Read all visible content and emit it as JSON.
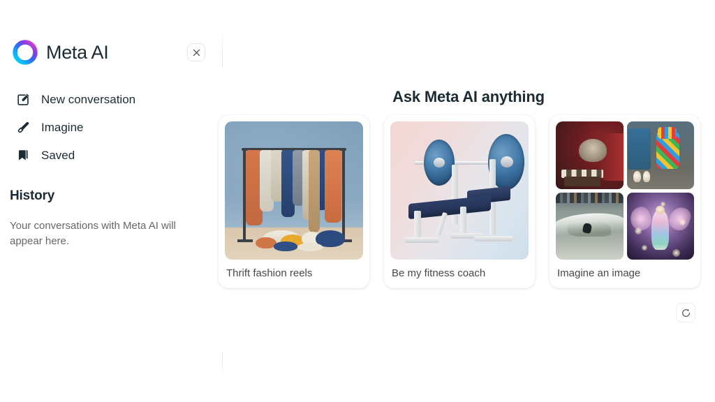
{
  "brand": {
    "title": "Meta AI",
    "logo_icon": "meta-ai-ring-logo",
    "logo_gradient_start": "#0ac2ff",
    "logo_gradient_mid": "#2b6bf5",
    "logo_gradient_end": "#c034e0"
  },
  "sidebar": {
    "close_icon": "close-icon",
    "items": [
      {
        "label": "New conversation",
        "icon": "compose-icon"
      },
      {
        "label": "Imagine",
        "icon": "brush-icon"
      },
      {
        "label": "Saved",
        "icon": "bookmark-icon"
      }
    ],
    "history": {
      "title": "History",
      "empty_text": "Your conversations with Meta AI will appear here."
    }
  },
  "main": {
    "heading": "Ask Meta AI anything",
    "cards": [
      {
        "label": "Thrift fashion reels",
        "media": "clothing-rack-photo"
      },
      {
        "label": "Be my fitness coach",
        "media": "weight-bench-photo"
      },
      {
        "label": "Imagine an image",
        "media": "image-grid",
        "tiles": [
          "hedgehog-playing-chess",
          "colorful-robot-walking-dogs",
          "surfer-riding-wave",
          "glowing-fairy"
        ]
      }
    ],
    "refresh_icon": "refresh-icon"
  },
  "colors": {
    "text_primary": "#1c2b33",
    "text_secondary": "#65676b",
    "card_label": "#44494d",
    "background": "#ffffff",
    "divider": "#dbdee2"
  }
}
